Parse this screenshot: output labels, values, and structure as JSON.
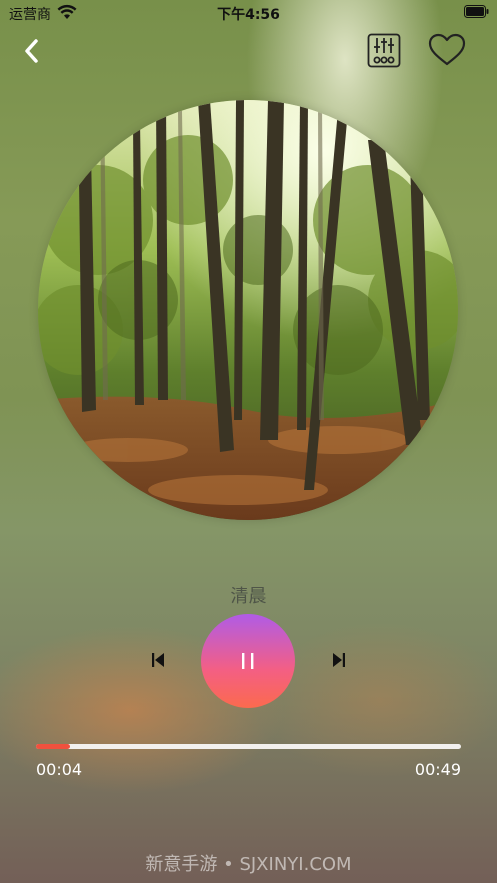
{
  "status_bar": {
    "carrier": "运营商",
    "time": "下午4:56",
    "wifi_icon": "wifi-icon",
    "battery_icon": "battery-icon"
  },
  "header": {
    "back_icon": "chevron-left-icon",
    "equalizer_icon": "equalizer-icon",
    "favorite_icon": "heart-outline-icon"
  },
  "player": {
    "cover_image": "forest-cover",
    "title": "清晨",
    "controls": {
      "previous_icon": "skip-previous-icon",
      "play_pause_icon": "pause-icon",
      "next_icon": "skip-next-icon"
    },
    "progress": {
      "current": "00:04",
      "total": "00:49",
      "fraction": 0.08
    }
  },
  "colors": {
    "progress_fill": "#f0513e",
    "play_gradient_top": "#b05ce6",
    "play_gradient_bottom": "#fb6a4e"
  },
  "watermark": "新意手游 • SJXINYI.COM"
}
